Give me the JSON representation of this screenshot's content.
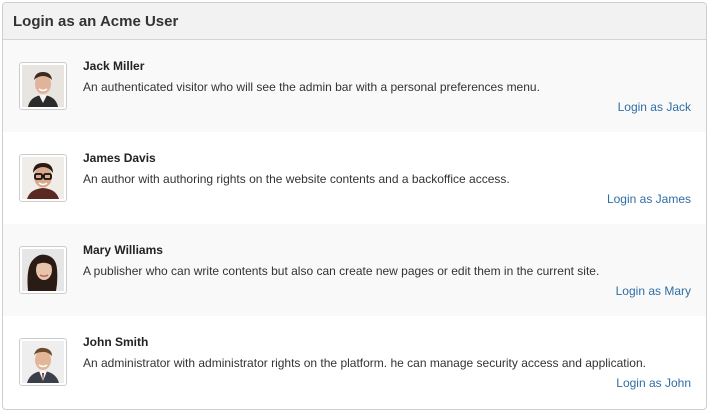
{
  "panel": {
    "title": "Login as an Acme User"
  },
  "users": [
    {
      "name": "Jack Miller",
      "description": "An authenticated visitor who will see the admin bar with a personal preferences menu.",
      "login_label": "Login as Jack",
      "avatar_icon": "user-photo-jack"
    },
    {
      "name": "James Davis",
      "description": "An author with authoring rights on the website contents and a backoffice access.",
      "login_label": "Login as James",
      "avatar_icon": "user-photo-james"
    },
    {
      "name": "Mary Williams",
      "description": "A publisher who can write contents but also can create new pages or edit them in the current site.",
      "login_label": "Login as Mary",
      "avatar_icon": "user-photo-mary"
    },
    {
      "name": "John Smith",
      "description": "An administrator with administrator rights on the platform. he can manage security access and application.",
      "login_label": "Login as John",
      "avatar_icon": "user-photo-john"
    }
  ],
  "colors": {
    "link": "#2f6ea5",
    "header_bg": "#f2f2f2",
    "row_shade": "#f9f9f9"
  }
}
